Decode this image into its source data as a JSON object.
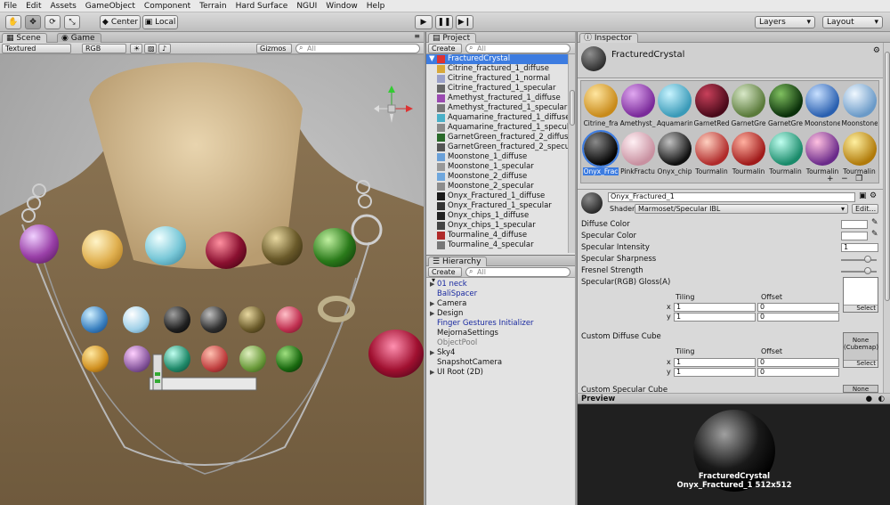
{
  "menu": [
    "File",
    "Edit",
    "Assets",
    "GameObject",
    "Component",
    "Terrain",
    "Hard Surface",
    "NGUI",
    "Window",
    "Help"
  ],
  "toolbar": {
    "pivot_center": "Center",
    "pivot_local": "Local",
    "layers": "Layers",
    "layout": "Layout"
  },
  "scene": {
    "tab_scene": "Scene",
    "tab_game": "Game",
    "render_mode": "Textured",
    "color_mode": "RGB",
    "gizmos": "Gizmos",
    "search_placeholder": "All"
  },
  "project": {
    "tab": "Project",
    "create": "Create",
    "search_placeholder": "All",
    "selected_folder": "FracturedCrystal",
    "items": [
      {
        "label": "Citrine_fractured_1_diffuse",
        "color": "#d8a83a"
      },
      {
        "label": "Citrine_fractured_1_normal",
        "color": "#9aa0c8"
      },
      {
        "label": "Citrine_fractured_1_specular",
        "color": "#666666"
      },
      {
        "label": "Amethyst_fractured_1_diffuse",
        "color": "#9a4ab0"
      },
      {
        "label": "Amethyst_fractured_1_specular",
        "color": "#777777"
      },
      {
        "label": "Aquamarine_fractured_1_diffuse",
        "color": "#4ab0c8"
      },
      {
        "label": "Aquamarine_fractured_1_specular",
        "color": "#8a8a8a"
      },
      {
        "label": "GarnetGreen_fractured_2_diffuse",
        "color": "#2a6a2a"
      },
      {
        "label": "GarnetGreen_fractured_2_specular",
        "color": "#555555"
      },
      {
        "label": "Moonstone_1_diffuse",
        "color": "#6aa0d8"
      },
      {
        "label": "Moonstone_1_specular",
        "color": "#999999"
      },
      {
        "label": "Moonstone_2_diffuse",
        "color": "#6fa7dd"
      },
      {
        "label": "Moonstone_2_specular",
        "color": "#8d8d8d"
      },
      {
        "label": "Onyx_Fractured_1_diffuse",
        "color": "#1a1a1a"
      },
      {
        "label": "Onyx_Fractured_1_specular",
        "color": "#333333"
      },
      {
        "label": "Onyx_chips_1_diffuse",
        "color": "#222222"
      },
      {
        "label": "Onyx_chips_1_specular",
        "color": "#444444"
      },
      {
        "label": "Tourmaline_4_diffuse",
        "color": "#b02a2a"
      },
      {
        "label": "Tourmaline_4_specular",
        "color": "#777777"
      }
    ]
  },
  "hierarchy": {
    "tab": "Hierarchy",
    "create": "Create",
    "search_placeholder": "All",
    "items": [
      {
        "label": "01 neck",
        "arrow": "▶",
        "color": "#1a2aa0"
      },
      {
        "label": "BaliSpacer",
        "arrow": "",
        "color": "#1a2aa0"
      },
      {
        "label": "Camera",
        "arrow": "▶",
        "color": "#111111"
      },
      {
        "label": "Design",
        "arrow": "▶",
        "color": "#111111"
      },
      {
        "label": "Finger Gestures Initializer",
        "arrow": "",
        "color": "#1a2aa0"
      },
      {
        "label": "MejornaSettings",
        "arrow": "",
        "color": "#111111"
      },
      {
        "label": "ObjectPool",
        "arrow": "",
        "color": "#777777"
      },
      {
        "label": "Sky4",
        "arrow": "▶",
        "color": "#111111"
      },
      {
        "label": "SnapshotCamera",
        "arrow": "",
        "color": "#111111"
      },
      {
        "label": "UI Root (2D)",
        "arrow": "▶",
        "color": "#111111"
      }
    ]
  },
  "inspector": {
    "tab": "Inspector",
    "object_name": "FracturedCrystal",
    "materials_row1": [
      {
        "label": "Citrine_fra",
        "c1": "#ffe6a0",
        "c2": "#c88a1a"
      },
      {
        "label": "Amethyst_",
        "c1": "#e0a8f0",
        "c2": "#7a2a9a"
      },
      {
        "label": "Aquamarin",
        "c1": "#c8f4ff",
        "c2": "#3a9ab8"
      },
      {
        "label": "GarnetRed",
        "c1": "#c8405a",
        "c2": "#4a0a1a"
      },
      {
        "label": "GarnetGre",
        "c1": "#d8e8c8",
        "c2": "#5a7a3a"
      },
      {
        "label": "GarnetGre",
        "c1": "#80c060",
        "c2": "#0a300a"
      },
      {
        "label": "Moonstone",
        "c1": "#c8e0ff",
        "c2": "#2a60b0"
      },
      {
        "label": "Moonstone",
        "c1": "#f0f8ff",
        "c2": "#6a9ac8"
      }
    ],
    "materials_row2": [
      {
        "label": "Onyx_Frac",
        "c1": "#8a8a8a",
        "c2": "#050505"
      },
      {
        "label": "PinkFractu",
        "c1": "#fff0f4",
        "c2": "#c890a0"
      },
      {
        "label": "Onyx_chip",
        "c1": "#c0c0c0",
        "c2": "#101010"
      },
      {
        "label": "Tourmalin",
        "c1": "#ffd0c0",
        "c2": "#b02a2a"
      },
      {
        "label": "Tourmalin",
        "c1": "#ffb0a0",
        "c2": "#a01a1a"
      },
      {
        "label": "Tourmalin",
        "c1": "#c0fff0",
        "c2": "#1a8a6a"
      },
      {
        "label": "Tourmalin",
        "c1": "#ffc0e0",
        "c2": "#6a2a8a"
      },
      {
        "label": "Tourmalin",
        "c1": "#fff0a0",
        "c2": "#b07a0a"
      }
    ],
    "material_name": "Onyx_Fractured_1",
    "shader_label": "Shader",
    "shader_value": "Marmoset/Specular IBL",
    "edit_label": "Edit...",
    "properties": {
      "diffuse_color": "Diffuse Color",
      "specular_color": "Specular Color",
      "specular_intensity": "Specular Intensity",
      "specular_intensity_value": "1",
      "specular_sharpness": "Specular Sharpness",
      "fresnel_strength": "Fresnel Strength",
      "specular_gloss": "Specular(RGB) Gloss(A)",
      "tiling": "Tiling",
      "offset": "Offset",
      "x": "x",
      "y": "y",
      "tiling_x": "1",
      "tiling_y": "1",
      "offset_x": "0",
      "offset_y": "0",
      "select": "Select",
      "custom_diffuse_cube": "Custom Diffuse Cube",
      "cube_none": "None",
      "cube_type": "(Cubemap)",
      "custom_specular_cube": "Custom Specular Cube",
      "cube_none2": "None"
    }
  },
  "preview": {
    "title": "Preview",
    "line1": "FracturedCrystal",
    "line2": "Onyx_Fractured_1  512x512"
  }
}
